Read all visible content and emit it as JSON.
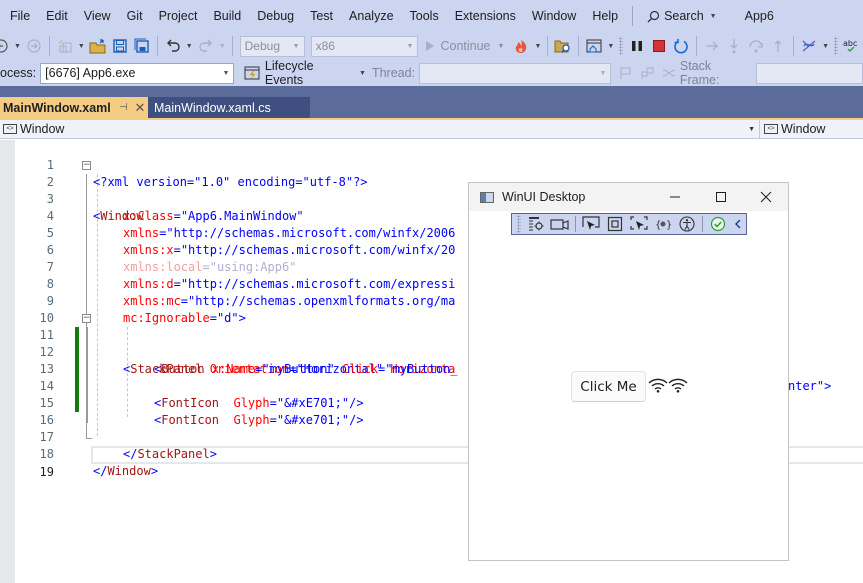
{
  "menu": {
    "items": [
      "File",
      "Edit",
      "View",
      "Git",
      "Project",
      "Build",
      "Debug",
      "Test",
      "Analyze",
      "Tools",
      "Extensions",
      "Window",
      "Help"
    ],
    "search_label": "Search",
    "app_title": "App6"
  },
  "toolbar": {
    "config_value": "Debug",
    "platform_value": "x86",
    "continue_label": "Continue"
  },
  "debug_bar": {
    "process_label": "ocess:",
    "process_value": "[6676] App6.exe",
    "lifecycle_label": "Lifecycle Events",
    "thread_label": "Thread:",
    "stack_frame_label": "Stack Frame:"
  },
  "tabs": {
    "active": "MainWindow.xaml",
    "inactive": "MainWindow.xaml.cs"
  },
  "navbar": {
    "left_value": "Window",
    "right_value": "Window"
  },
  "editor": {
    "line_numbers": [
      "1",
      "2",
      "3",
      "4",
      "5",
      "6",
      "7",
      "8",
      "9",
      "10",
      "11",
      "12",
      "13",
      "14",
      "15",
      "16",
      "17",
      "18",
      "19"
    ],
    "lines": {
      "l1": "<?xml version=\"1.0\" encoding=\"utf-8\"?>",
      "l2_tag": "Window",
      "l3_attr": "x:Class",
      "l3_val": "\"App6.MainWindow\"",
      "l4_attr": "xmlns",
      "l4_val": "\"http://schemas.microsoft.com/winfx/2006",
      "l5_attr": "xmlns:x",
      "l5_val": "\"http://schemas.microsoft.com/winfx/20",
      "l6_attr": "xmlns:local",
      "l6_val": "\"using:App6\"",
      "l7_attr": "xmlns:d",
      "l7_val": "\"http://schemas.microsoft.com/expressi",
      "l8_attr": "xmlns:mc",
      "l8_val": "\"http://schemas.openxmlformats.org/ma",
      "l9_attr": "mc:Ignorable",
      "l9_val": "\"d\"",
      "l11_tag": "StackPanel",
      "l11_attr1": "Orientation",
      "l11_val1": "\"Horizontal\"",
      "l11_attr2": "Horizonta",
      "l11_tail": "nter\">",
      "l12_tag": "Button",
      "l12_attr1": "x:Name",
      "l12_val1": "\"myButton\"",
      "l12_attr2": "Click",
      "l12_val2": "\"myButton_",
      "l14_tag": "FontIcon",
      "l14_attr": "Glyph",
      "l14_val": "\"&#xE701;\"",
      "l15_tag": "FontIcon",
      "l15_attr": "Glyph",
      "l15_val": "\"&#xe701;\"",
      "l17_tag": "StackPanel",
      "l18_tag": "Window"
    }
  },
  "winui_window": {
    "title": "WinUI Desktop",
    "button_label": "Click Me",
    "font_icon_count": 2
  },
  "colors": {
    "chrome_bg": "#ccd5f0",
    "tab_active": "#f5cc84",
    "tab_well": "#5b6b9a",
    "change_bar": "#107c10",
    "stop_red": "#d13438"
  }
}
